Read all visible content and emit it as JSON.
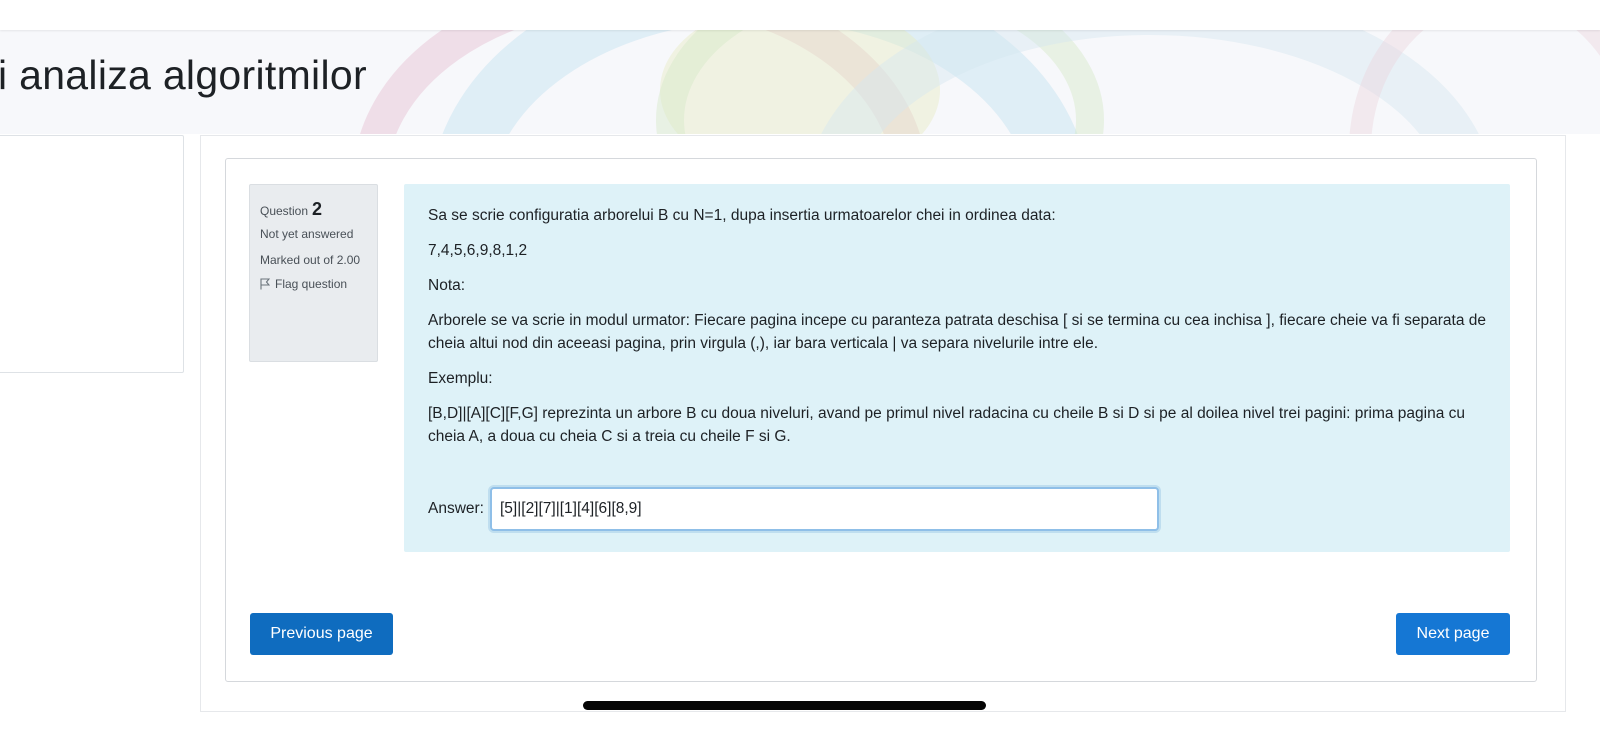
{
  "course": {
    "title": "i analiza algoritmilor"
  },
  "question_info": {
    "label": "Question",
    "number": "2",
    "state": "Not yet answered",
    "grade": "Marked out of 2.00",
    "flag_label": "Flag question"
  },
  "question": {
    "prompt": "Sa se scrie configuratia arborelui B cu N=1, dupa insertia urmatoarelor chei in ordinea data:",
    "keys": "7,4,5,6,9,8,1,2",
    "note_heading": "Nota:",
    "note_text": "Arborele se va scrie in modul urmator: Fiecare pagina incepe cu paranteza patrata deschisa [ si se termina cu cea inchisa ], fiecare cheie va fi separata de cheia altui nod din aceeasi pagina, prin virgula (,), iar bara verticala | va separa nivelurile intre ele.",
    "example_heading": "Exemplu:",
    "example_text": "[B,D]|[A][C][F,G] reprezinta un arbore B cu doua niveluri, avand pe primul nivel radacina cu cheile B si D si pe al doilea nivel trei pagini: prima pagina cu cheia A, a doua cu cheia C si a treia cu cheile F si G."
  },
  "answer": {
    "label": "Answer:",
    "value": "[5]|[2][7]|[1][4][6][8,9]"
  },
  "navigation": {
    "previous_label": "Previous page",
    "next_label": "Next page"
  },
  "colors": {
    "primary": "#0f6cbf",
    "content_bg": "#def2f8",
    "info_bg": "#e9ecef"
  }
}
